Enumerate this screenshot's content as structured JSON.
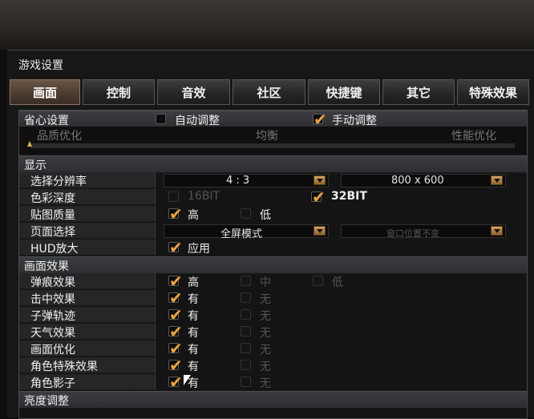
{
  "window_title": "游戏设置",
  "tabs": [
    {
      "label": "画面"
    },
    {
      "label": "控制"
    },
    {
      "label": "音效"
    },
    {
      "label": "社区"
    },
    {
      "label": "快捷键"
    },
    {
      "label": "其它"
    },
    {
      "label": "特殊效果"
    }
  ],
  "active_tab": "画面",
  "preset": {
    "label": "省心设置",
    "auto_label": "自动调整",
    "manual_label": "手动调整",
    "selected": "manual",
    "quality_left": "品质优化",
    "quality_mid": "均衡",
    "quality_right": "性能优化"
  },
  "display": {
    "title": "显示",
    "resolution_label": "选择分辨率",
    "aspect_value": "4 : 3",
    "resolution_value": "800 x 600",
    "color_depth_label": "色彩深度",
    "color16": "16BIT",
    "color32": "32BIT",
    "texture_label": "贴图质量",
    "texture_high": "高",
    "texture_low": "低",
    "screen_label": "页面选择",
    "screen_mode": "全屏模式",
    "window_pos": "窗口位置不变",
    "hud_label": "HUD放大",
    "hud_apply": "应用"
  },
  "effects": {
    "title": "画面效果",
    "rows": [
      {
        "label": "弹痕效果",
        "opt1": "高",
        "opt2": "中",
        "opt3": "低"
      },
      {
        "label": "击中效果",
        "opt1": "有",
        "opt2": "无"
      },
      {
        "label": "子弹轨迹",
        "opt1": "有",
        "opt2": "无"
      },
      {
        "label": "天气效果",
        "opt1": "有",
        "opt2": "无"
      },
      {
        "label": "画面优化",
        "opt1": "有",
        "opt2": "无"
      },
      {
        "label": "角色特殊效果",
        "opt1": "有",
        "opt2": "无"
      },
      {
        "label": "角色影子",
        "opt1": "有",
        "opt2": "无"
      }
    ]
  },
  "brightness": {
    "title": "亮度调整"
  },
  "colors": {
    "accent": "#f2a23a",
    "tab_active": "#4d3c30"
  }
}
